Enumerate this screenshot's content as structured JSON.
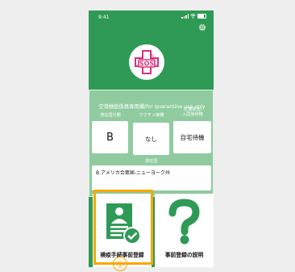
{
  "status_bar": {
    "time": "9:41"
  },
  "logo": {
    "top_text": "My",
    "main_text": "SOS"
  },
  "quarantine_panel": {
    "heading": "空港検疫係員専用欄/for quarantine use only",
    "columns": [
      {
        "label": "滞在国分類",
        "value": "B"
      },
      {
        "label": "ワクチン接種",
        "value": "なし"
      },
      {
        "label_line1": "空港検査/",
        "label_line2": "入国後待機",
        "value": "自宅待機"
      }
    ],
    "residence_label": "滞在国",
    "residence_value": "B.アメリカ合衆国-ニューヨーク州"
  },
  "tiles": [
    {
      "label": "検疫手続事前登録"
    },
    {
      "label": "事前登録の説明"
    }
  ],
  "step_marker": "①",
  "colors": {
    "primary_green": "#2e9a55",
    "highlight": "#f6a800",
    "logo_pink": "#d6337a"
  }
}
